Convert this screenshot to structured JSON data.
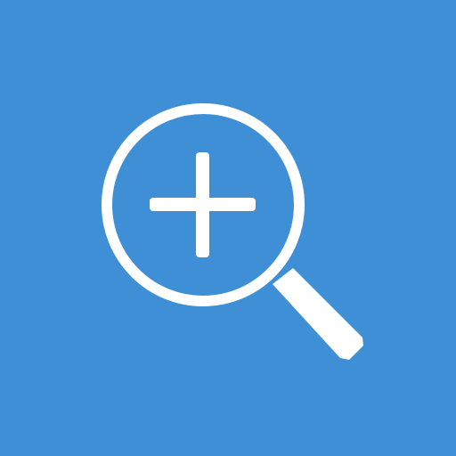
{
  "icon": {
    "name": "zoom-in-icon",
    "background_color": "#3f8fd6",
    "foreground_color": "#ffffff"
  }
}
